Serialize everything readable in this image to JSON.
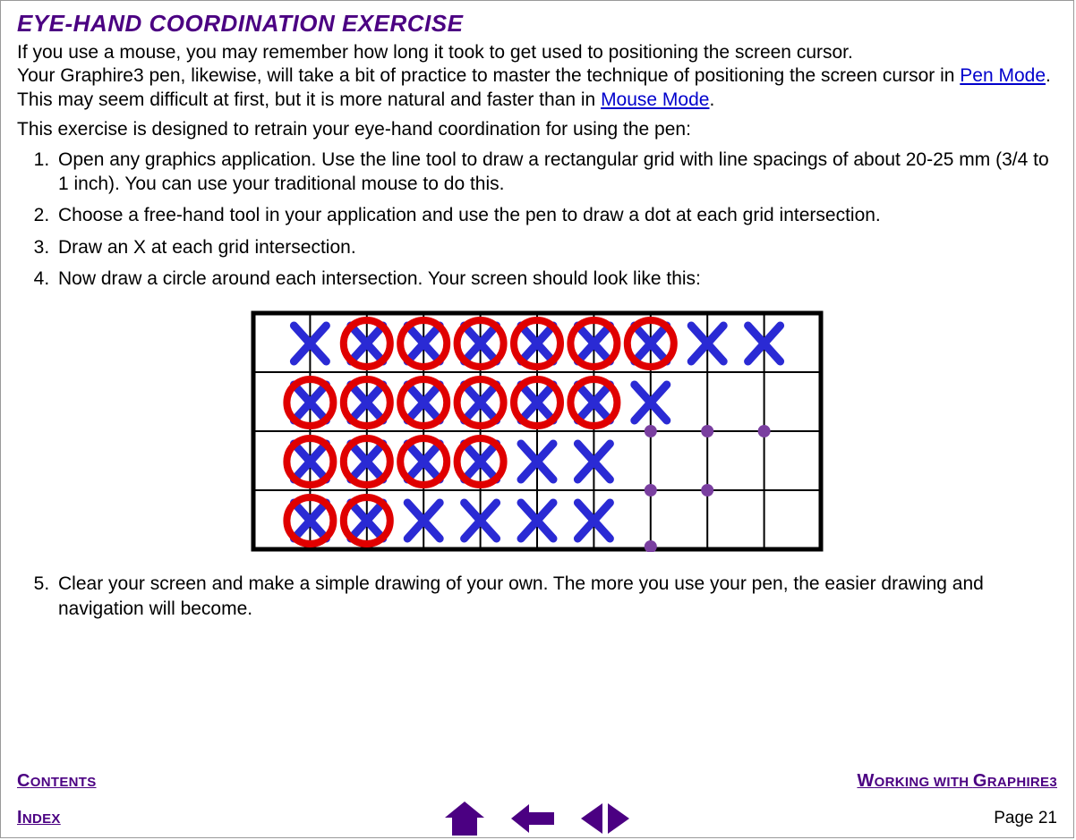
{
  "title": "EYE-HAND COORDINATION EXERCISE",
  "intro_line1": "If you use a mouse, you may remember how long it took to get used to positioning the screen cursor.",
  "intro_line2a": "Your Graphire3 pen, likewise, will take a bit of practice to master the technique of positioning the screen cursor in ",
  "intro_link1": "Pen Mode",
  "intro_line2b": ".  This may seem difficult at first, but it is more natural and faster than in ",
  "intro_link2": "Mouse Mode",
  "intro_line2c": ".",
  "lead": "This exercise is designed to retrain your eye-hand coordination for using the pen:",
  "steps": [
    "Open any graphics application.  Use the line tool to draw a rectangular grid with line spacings of about 20-25 mm (3/4 to 1 inch).  You can use your traditional mouse to do this.",
    "Choose a free-hand tool in your application and use the pen to draw a dot at each grid intersection.",
    "Draw an X at each grid intersection.",
    "Now draw a circle around each intersection.  Your screen should look like this:",
    "Clear your screen and make a simple drawing of your own.  The more you use your pen, the easier drawing and navigation will become."
  ],
  "footer": {
    "contents": "Contents",
    "index": "Index",
    "working": "Working with Graphire3",
    "page_label": "Page  21"
  }
}
